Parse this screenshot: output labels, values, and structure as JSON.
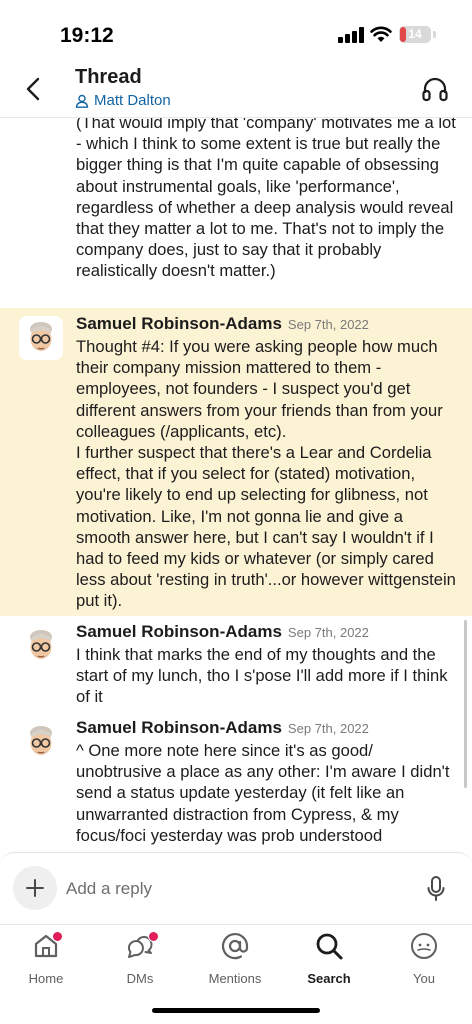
{
  "status_bar": {
    "time": "19:12",
    "battery": "14"
  },
  "header": {
    "title": "Thread",
    "subtitle": "Matt Dalton",
    "back_icon": "chevron-left-icon",
    "headphones_icon": "headphones-icon"
  },
  "messages": [
    {
      "author": "",
      "timestamp": "",
      "text": "(That would imply that 'company' motivates me a lot - which I think to some extent is true but really the bigger thing is that I'm quite capable of obsessing about instrumental goals, like 'performance', regardless of whether a deep analysis would reveal that they matter a lot to me. That's not to imply the company does, just to say that it probably realistically doesn't matter.)"
    },
    {
      "author": "Samuel Robinson-Adams",
      "timestamp": "Sep 7th, 2022",
      "highlighted": true,
      "text": "Thought #4: If you were asking people how much their company mission mattered to them - employees, not founders - I suspect you'd get different answers from your friends than from your colleagues (/applicants, etc).\nI further suspect that there's a Lear and Cordelia effect, that if you select for (stated) motivation, you're likely to end up selecting for glibness, not motivation. Like, I'm not gonna lie and give a smooth answer here, but I can't say I wouldn't if I had to feed my kids or whatever (or simply cared less about 'resting in truth'...or however wittgenstein put it)."
    },
    {
      "author": "Samuel Robinson-Adams",
      "timestamp": "Sep 7th, 2022",
      "text": "I think that marks the end of my thoughts and the start of my lunch, tho I s'pose I'll add more if I think of it"
    },
    {
      "author": "Samuel Robinson-Adams",
      "timestamp": "Sep 7th, 2022",
      "text": "^ One more note here since it's as good/ unobtrusive a place as any other: I'm aware I didn't send a status update yesterday (it felt like an unwarranted distraction from Cypress, & my focus/foci yesterday was prob understood"
    }
  ],
  "composer": {
    "placeholder": "Add a reply",
    "plus_icon": "plus-icon",
    "mic_icon": "microphone-icon"
  },
  "tabs": [
    {
      "label": "Home",
      "icon": "home-icon",
      "badge": true
    },
    {
      "label": "DMs",
      "icon": "chat-bubbles-icon",
      "badge": true
    },
    {
      "label": "Mentions",
      "icon": "at-sign-icon",
      "badge": false
    },
    {
      "label": "Search",
      "icon": "search-icon",
      "badge": false,
      "active": true
    },
    {
      "label": "You",
      "icon": "profile-icon",
      "badge": false
    }
  ],
  "colors": {
    "highlight": "#fcf3d4",
    "link": "#1264a3",
    "badge": "#e01e5a"
  }
}
